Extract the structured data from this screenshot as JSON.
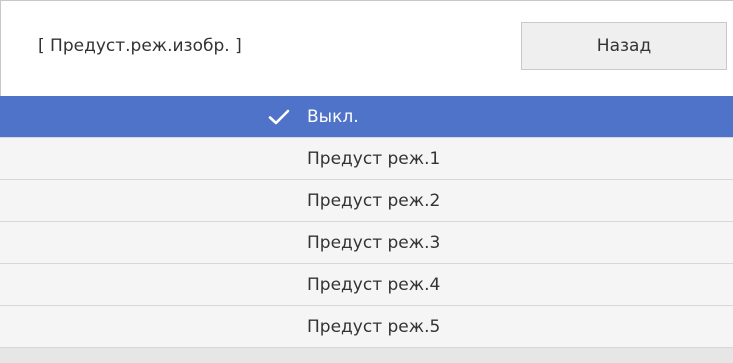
{
  "header": {
    "title": "[ Предуст.реж.изобр. ]",
    "back_label": "Назад"
  },
  "options": [
    {
      "label": "Выкл.",
      "selected": true,
      "icon": "check-icon"
    },
    {
      "label": "Предуст реж.1",
      "selected": false
    },
    {
      "label": "Предуст реж.2",
      "selected": false
    },
    {
      "label": "Предуст реж.3",
      "selected": false
    },
    {
      "label": "Предуст реж.4",
      "selected": false
    },
    {
      "label": "Предуст реж.5",
      "selected": false
    }
  ],
  "colors": {
    "selected_bg": "#4f73c8",
    "item_bg": "#f5f5f5",
    "text": "#333333"
  }
}
